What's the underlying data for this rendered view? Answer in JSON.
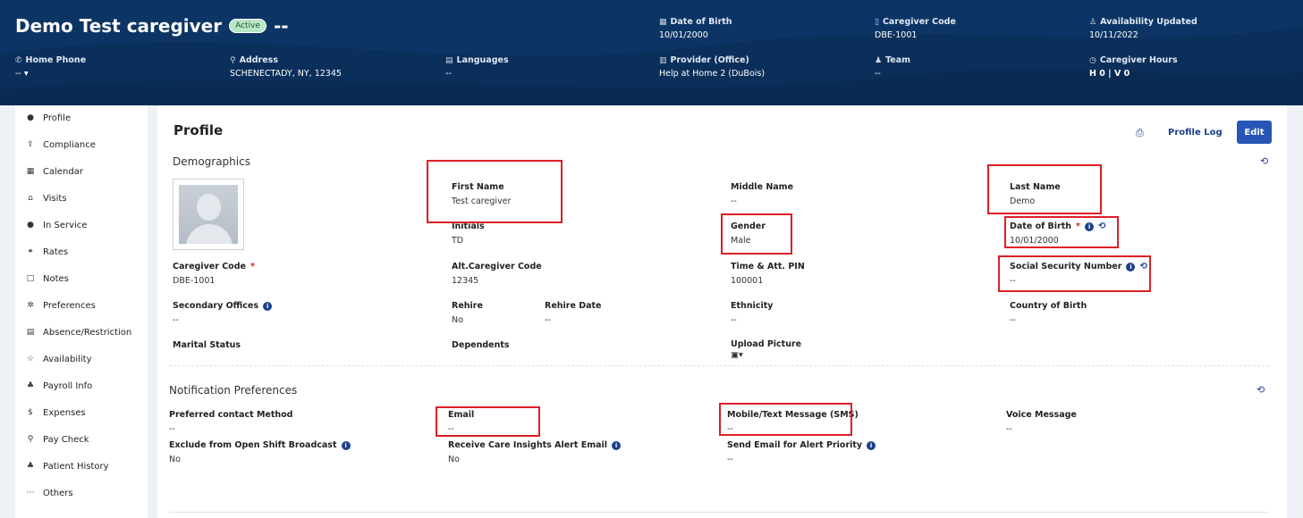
{
  "header": {
    "name": "Demo Test caregiver",
    "status": "Active",
    "status_suffix": "--",
    "date_of_birth": {
      "label": "Date of Birth",
      "value": "10/01/2000"
    },
    "caregiver_code": {
      "label": "Caregiver Code",
      "value": "DBE-1001"
    },
    "availability_updated": {
      "label": "Availability Updated",
      "value": "10/11/2022"
    },
    "home_phone": {
      "label": "Home Phone",
      "value": "--"
    },
    "address": {
      "label": "Address",
      "value": "SCHENECTADY, NY, 12345"
    },
    "languages": {
      "label": "Languages",
      "value": "--"
    },
    "provider": {
      "label": "Provider (Office)",
      "value": "Help at Home 2 (DuBois)"
    },
    "team": {
      "label": "Team",
      "value": "--"
    },
    "caregiver_hours": {
      "label": "Caregiver Hours",
      "value": "H 0 | V 0"
    }
  },
  "sidebar": {
    "items": [
      {
        "label": "Profile",
        "icon": "user-icon"
      },
      {
        "label": "Compliance",
        "icon": "compliance-icon"
      },
      {
        "label": "Calendar",
        "icon": "calendar-icon"
      },
      {
        "label": "Visits",
        "icon": "home-icon"
      },
      {
        "label": "In Service",
        "icon": "circle-icon"
      },
      {
        "label": "Rates",
        "icon": "handshake-icon"
      },
      {
        "label": "Notes",
        "icon": "note-icon"
      },
      {
        "label": "Preferences",
        "icon": "gear-icon"
      },
      {
        "label": "Absence/Restriction",
        "icon": "calendar-x-icon"
      },
      {
        "label": "Availability",
        "icon": "star-icon"
      },
      {
        "label": "Payroll Info",
        "icon": "users-icon"
      },
      {
        "label": "Expenses",
        "icon": "dollar-icon"
      },
      {
        "label": "Pay Check",
        "icon": "search-icon"
      },
      {
        "label": "Patient History",
        "icon": "users-icon"
      },
      {
        "label": "Others",
        "icon": "more-icon"
      }
    ]
  },
  "main": {
    "title": "Profile",
    "profile_log": "Profile Log",
    "edit": "Edit",
    "demographics_title": "Demographics",
    "notification_title": "Notification Preferences",
    "fields": {
      "first_name": {
        "label": "First Name",
        "value": "Test caregiver"
      },
      "middle_name": {
        "label": "Middle Name",
        "value": "--"
      },
      "last_name": {
        "label": "Last Name",
        "value": "Demo"
      },
      "initials": {
        "label": "Initials",
        "value": "TD"
      },
      "gender": {
        "label": "Gender",
        "value": "Male"
      },
      "dob": {
        "label": "Date of Birth",
        "value": "10/01/2000"
      },
      "caregiver_code": {
        "label": "Caregiver Code",
        "value": "DBE-1001"
      },
      "alt_code": {
        "label": "Alt.Caregiver Code",
        "value": "12345"
      },
      "pin": {
        "label": "Time & Att. PIN",
        "value": "100001"
      },
      "ssn": {
        "label": "Social Security Number",
        "value": "--"
      },
      "secondary_offices": {
        "label": "Secondary Offices",
        "value": "--"
      },
      "rehire": {
        "label": "Rehire",
        "value": "No"
      },
      "rehire_date": {
        "label": "Rehire Date",
        "value": "--"
      },
      "ethnicity": {
        "label": "Ethnicity",
        "value": "--"
      },
      "country_of_birth": {
        "label": "Country of Birth",
        "value": "--"
      },
      "marital_status": {
        "label": "Marital Status",
        "value": ""
      },
      "dependents": {
        "label": "Dependents",
        "value": ""
      },
      "upload_picture": {
        "label": "Upload Picture",
        "value": ""
      }
    },
    "notifications": {
      "preferred": {
        "label": "Preferred contact Method",
        "value": "--"
      },
      "email": {
        "label": "Email",
        "value": "--"
      },
      "sms": {
        "label": "Mobile/Text Message (SMS)",
        "value": "--"
      },
      "voice": {
        "label": "Voice Message",
        "value": "--"
      },
      "exclude": {
        "label": "Exclude from Open Shift Broadcast",
        "value": "No"
      },
      "care_insights": {
        "label": "Receive Care Insights Alert Email",
        "value": "No"
      },
      "alert_priority": {
        "label": "Send Email for Alert Priority",
        "value": "--"
      }
    }
  },
  "colors": {
    "header_bg": "#0b2f5b",
    "accent": "#2856b6",
    "highlight": "#dd1f26",
    "badge": "#b9e6c6"
  }
}
